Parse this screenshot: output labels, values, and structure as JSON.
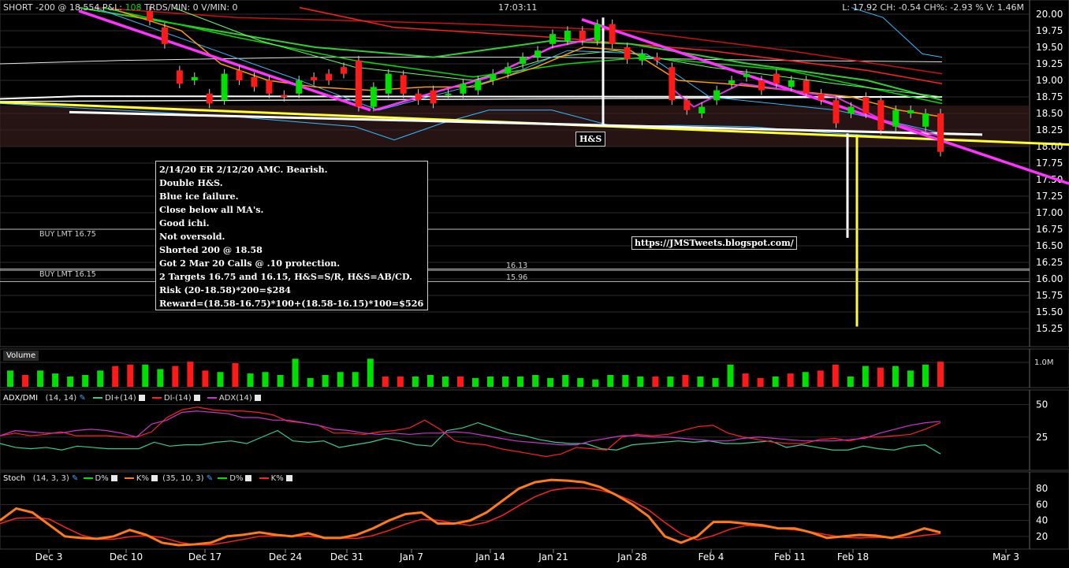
{
  "header": {
    "left": "SHORT -200 @ 18.554 P&L: ",
    "pnl": "108",
    "mid": " TRDS/MIN: 0 V/MIN: 0",
    "time": "17:03:11",
    "right": "L: 17.92 CH: -0.54 CH%: -2.93 % V: 1.46M"
  },
  "orders": {
    "buy1": "BUY LMT 16.75",
    "buy2": "BUY LMT 16.15",
    "lvl1": "16.13",
    "lvl2": "15.96"
  },
  "note": {
    "lines": [
      "2/14/20 ER 2/12/20 AMC. Bearish.",
      "Double H&S.",
      "Blue ice failure.",
      "Close below all MA's.",
      "Good ichi.",
      "Not oversold.",
      "Shorted 200 @ 18.58",
      "Got 2 Mar 20 Calls @ .10 protection.",
      "2 Targets 16.75 and 16.15, H&S=S/R, H&S=AB/CD.",
      "Risk (20-18.58)*200=$284",
      "Reward=(18.58-16.75)*100+(18.58-16.15)*100=$526"
    ]
  },
  "url": "https://JMSTweets.blogspot.com/",
  "hs_label": "H&S",
  "volume": {
    "title": "Volume",
    "axis_label": "1.0M"
  },
  "adx": {
    "title": "ADX/DMI",
    "params": "(14, 14)",
    "di_plus": "DI+(14)",
    "di_minus": "DI-(14)",
    "adx": "ADX(14)",
    "ticks": [
      "50",
      "25"
    ]
  },
  "stoch": {
    "title": "Stoch",
    "params1": "(14, 3, 3)",
    "params2": "(35, 10, 3)",
    "d": "D%",
    "k": "K%",
    "ticks": [
      "80",
      "60",
      "40",
      "20"
    ]
  },
  "x_labels": [
    "Dec 3",
    "Dec 10",
    "Dec 17",
    "Dec 24",
    "Dec 31",
    "Jan 7",
    "Jan 14",
    "Jan 21",
    "Jan 28",
    "Feb 4",
    "Feb 11",
    "Feb 18",
    "Mar 3"
  ],
  "colors": {
    "up": "#00e000",
    "down": "#ff1a1a",
    "pnl": "#00e000",
    "trend": "#ff33ff",
    "yellow": "#ffff33"
  },
  "chart_data": {
    "type": "candlestick",
    "y_ticks": [
      20.0,
      19.75,
      19.5,
      19.25,
      19.0,
      18.75,
      18.5,
      18.25,
      18.0,
      17.75,
      17.5,
      17.25,
      17.0,
      16.75,
      16.5,
      16.25,
      16.0,
      15.75,
      15.5,
      15.25
    ],
    "ylim": [
      15.12,
      20.08
    ],
    "candles": [
      {
        "o": 20.05,
        "c": 19.9
      },
      {
        "o": 19.8,
        "c": 19.55
      },
      {
        "o": 19.15,
        "c": 18.95
      },
      {
        "o": 19.0,
        "c": 19.05
      },
      {
        "o": 18.8,
        "c": 18.65
      },
      {
        "o": 18.7,
        "c": 19.1
      },
      {
        "o": 19.15,
        "c": 19.0
      },
      {
        "o": 19.05,
        "c": 18.9
      },
      {
        "o": 19.0,
        "c": 18.8
      },
      {
        "o": 18.78,
        "c": 18.75
      },
      {
        "o": 18.8,
        "c": 19.0
      },
      {
        "o": 19.05,
        "c": 19.0
      },
      {
        "o": 19.1,
        "c": 19.0
      },
      {
        "o": 19.2,
        "c": 19.1
      },
      {
        "o": 19.3,
        "c": 18.6
      },
      {
        "o": 18.6,
        "c": 18.9
      },
      {
        "o": 18.8,
        "c": 19.1
      },
      {
        "o": 19.08,
        "c": 18.8
      },
      {
        "o": 18.8,
        "c": 18.7
      },
      {
        "o": 18.85,
        "c": 18.65
      },
      {
        "o": 18.8,
        "c": 18.8
      },
      {
        "o": 18.8,
        "c": 18.95
      },
      {
        "o": 18.85,
        "c": 19.0
      },
      {
        "o": 19.0,
        "c": 19.1
      },
      {
        "o": 19.1,
        "c": 19.2
      },
      {
        "o": 19.25,
        "c": 19.35
      },
      {
        "o": 19.35,
        "c": 19.45
      },
      {
        "o": 19.55,
        "c": 19.7
      },
      {
        "o": 19.6,
        "c": 19.75
      },
      {
        "o": 19.75,
        "c": 19.6
      },
      {
        "o": 19.6,
        "c": 19.85
      },
      {
        "o": 19.85,
        "c": 19.55
      },
      {
        "o": 19.5,
        "c": 19.32
      },
      {
        "o": 19.3,
        "c": 19.4
      },
      {
        "o": 19.35,
        "c": 19.3
      },
      {
        "o": 19.2,
        "c": 18.7
      },
      {
        "o": 18.7,
        "c": 18.55
      },
      {
        "o": 18.5,
        "c": 18.6
      },
      {
        "o": 18.7,
        "c": 18.85
      },
      {
        "o": 18.95,
        "c": 19.0
      },
      {
        "o": 19.05,
        "c": 19.1
      },
      {
        "o": 19.0,
        "c": 18.85
      },
      {
        "o": 19.1,
        "c": 18.95
      },
      {
        "o": 18.9,
        "c": 19.0
      },
      {
        "o": 19.0,
        "c": 18.8
      },
      {
        "o": 18.8,
        "c": 18.7
      },
      {
        "o": 18.7,
        "c": 18.35
      },
      {
        "o": 18.5,
        "c": 18.6
      },
      {
        "o": 18.75,
        "c": 18.5
      },
      {
        "o": 18.7,
        "c": 18.25
      },
      {
        "o": 18.3,
        "c": 18.55
      },
      {
        "o": 18.5,
        "c": 18.55
      },
      {
        "o": 18.3,
        "c": 18.5
      },
      {
        "o": 18.5,
        "c": 17.92
      }
    ],
    "volume": [
      0.55,
      0.4,
      0.55,
      0.45,
      0.35,
      0.4,
      0.55,
      0.7,
      0.75,
      0.75,
      0.6,
      0.7,
      0.85,
      0.55,
      0.5,
      0.8,
      0.45,
      0.5,
      0.4,
      0.95,
      0.3,
      0.4,
      0.5,
      0.5,
      0.95,
      0.35,
      0.35,
      0.35,
      0.4,
      0.35,
      0.35,
      0.3,
      0.35,
      0.35,
      0.35,
      0.4,
      0.3,
      0.4,
      0.3,
      0.25,
      0.4,
      0.4,
      0.35,
      0.35,
      0.35,
      0.4,
      0.35,
      0.3,
      0.75,
      0.45,
      0.3,
      0.35,
      0.45,
      0.5,
      0.55,
      0.75,
      0.35,
      0.7,
      0.65,
      0.7,
      0.55,
      0.75,
      0.85
    ],
    "volume_ylim": [
      0,
      1.2
    ],
    "adx_ylim": [
      0,
      60
    ],
    "stoch_ylim": [
      5,
      100
    ],
    "di_plus": [
      20,
      17,
      16,
      17,
      15,
      18,
      17,
      16,
      16,
      16,
      21,
      18,
      19,
      19,
      21,
      22,
      20,
      25,
      30,
      22,
      21,
      22,
      17,
      19,
      21,
      24,
      22,
      19,
      18,
      30,
      32,
      36,
      32,
      28,
      26,
      23,
      21,
      20,
      20,
      16,
      15,
      19,
      20,
      21,
      22,
      21,
      22,
      20,
      20,
      21,
      22,
      17,
      19,
      17,
      15,
      15,
      18,
      16,
      15,
      18,
      19,
      12
    ],
    "di_minus": [
      26,
      28,
      26,
      27,
      29,
      26,
      26,
      26,
      25,
      25,
      29,
      40,
      46,
      48,
      46,
      45,
      45,
      44,
      42,
      37,
      36,
      34,
      28,
      28,
      27,
      29,
      30,
      32,
      38,
      31,
      22,
      20,
      19,
      16,
      14,
      12,
      10,
      12,
      17,
      16,
      15,
      25,
      27,
      26,
      27,
      30,
      33,
      34,
      28,
      25,
      23,
      21,
      20,
      20,
      23,
      24,
      22,
      25,
      25,
      26,
      27,
      31,
      36
    ],
    "adx": [
      26,
      30,
      29,
      28,
      28,
      30,
      31,
      30,
      28,
      25,
      35,
      38,
      44,
      45,
      44,
      43,
      40,
      40,
      38,
      38,
      36,
      34,
      31,
      30,
      28,
      27,
      28,
      27,
      28,
      28,
      29,
      28,
      26,
      24,
      22,
      21,
      20,
      19,
      19,
      22,
      24,
      26,
      26,
      25,
      25,
      24,
      23,
      22,
      22,
      24,
      25,
      24,
      23,
      22,
      22,
      22,
      23,
      24,
      28,
      31,
      34,
      36,
      37
    ],
    "stoch_k": [
      40,
      55,
      50,
      35,
      20,
      18,
      17,
      20,
      28,
      22,
      12,
      9,
      10,
      12,
      20,
      22,
      25,
      22,
      20,
      24,
      18,
      18,
      22,
      30,
      40,
      48,
      50,
      36,
      36,
      40,
      50,
      65,
      80,
      88,
      91,
      90,
      88,
      82,
      72,
      60,
      45,
      20,
      12,
      20,
      38,
      38,
      36,
      34,
      30,
      30,
      25,
      18,
      20,
      22,
      21,
      18,
      23,
      30,
      25
    ]
  }
}
